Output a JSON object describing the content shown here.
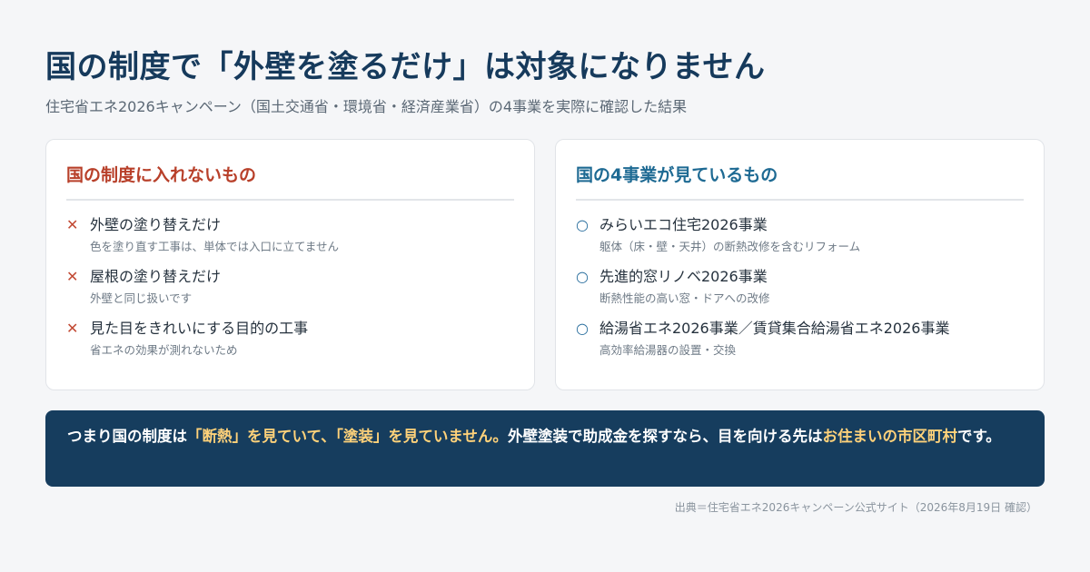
{
  "header": {
    "title": "国の制度で「外壁を塗るだけ」は対象になりません",
    "subtitle": "住宅省エネ2026キャンペーン（国土交通省・環境省・経済産業省）の4事業を実際に確認した結果"
  },
  "left_card": {
    "title": "国の制度に入れないもの",
    "mark_icon": "cross-icon",
    "items": [
      {
        "mark": "✕",
        "main": "外壁の塗り替えだけ",
        "sub": "色を塗り直す工事は、単体では入口に立てません"
      },
      {
        "mark": "✕",
        "main": "屋根の塗り替えだけ",
        "sub": "外壁と同じ扱いです"
      },
      {
        "mark": "✕",
        "main": "見た目をきれいにする目的の工事",
        "sub": "省エネの効果が測れないため"
      }
    ]
  },
  "right_card": {
    "title": "国の4事業が見ているもの",
    "mark_icon": "circle-icon",
    "items": [
      {
        "mark": "○",
        "main": "みらいエコ住宅2026事業",
        "sub": "躯体（床・壁・天井）の断熱改修を含むリフォーム"
      },
      {
        "mark": "○",
        "main": "先進的窓リノベ2026事業",
        "sub": "断熱性能の高い窓・ドアへの改修"
      },
      {
        "mark": "○",
        "main": "給湯省エネ2026事業／賃貸集合給湯省エネ2026事業",
        "sub": "高効率給湯器の設置・交換"
      }
    ]
  },
  "banner": {
    "part1": "つまり国の制度は",
    "highlight1": "「断熱」を見ていて、「塗装」を見ていません。",
    "part2": "外壁塗装で助成金を探すなら、目を向ける先は",
    "highlight2": "お住まいの市区町村",
    "part3": "です。"
  },
  "source": "出典＝住宅省エネ2026キャンペーン公式サイト（2026年8月19日 確認）",
  "colors": {
    "title": "#163a5c",
    "negative_accent": "#b8402a",
    "positive_accent": "#1e6a93",
    "banner_bg": "#163d5e",
    "banner_highlight": "#ffd27a"
  }
}
